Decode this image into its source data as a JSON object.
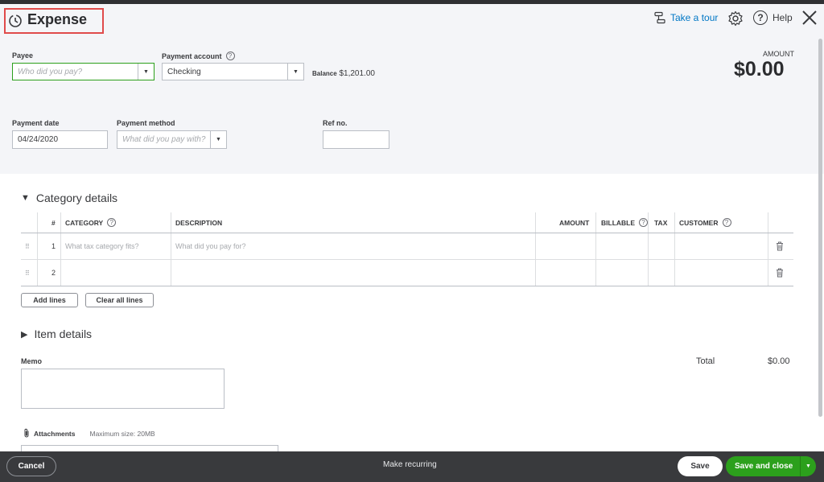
{
  "page": {
    "title": "Expense",
    "take_tour": "Take a tour",
    "help": "Help"
  },
  "form": {
    "payee": {
      "label": "Payee",
      "placeholder": "Who did you pay?"
    },
    "payment_account": {
      "label": "Payment account",
      "value": "Checking"
    },
    "balance": {
      "label": "Balance",
      "value": "$1,201.00"
    },
    "amount": {
      "label": "AMOUNT",
      "value": "$0.00"
    },
    "payment_date": {
      "label": "Payment date",
      "value": "04/24/2020"
    },
    "payment_method": {
      "label": "Payment method",
      "placeholder": "What did you pay with?"
    },
    "ref_no": {
      "label": "Ref no.",
      "value": ""
    }
  },
  "category_details": {
    "title": "Category details",
    "columns": {
      "num": "#",
      "category": "CATEGORY",
      "description": "DESCRIPTION",
      "amount": "AMOUNT",
      "billable": "BILLABLE",
      "tax": "TAX",
      "customer": "CUSTOMER"
    },
    "rows": [
      {
        "num": "1",
        "category_placeholder": "What tax category fits?",
        "description_placeholder": "What did you pay for?"
      },
      {
        "num": "2",
        "category_placeholder": "",
        "description_placeholder": ""
      }
    ],
    "add_lines": "Add lines",
    "clear_all_lines": "Clear all lines"
  },
  "item_details": {
    "title": "Item details"
  },
  "memo": {
    "label": "Memo"
  },
  "total": {
    "label": "Total",
    "value": "$0.00"
  },
  "attachments": {
    "label": "Attachments",
    "max_size": "Maximum size: 20MB"
  },
  "footer": {
    "cancel": "Cancel",
    "make_recurring": "Make recurring",
    "save": "Save",
    "save_and_close": "Save and close"
  },
  "colors": {
    "primary_green": "#2ca01c",
    "link_blue": "#0077c5",
    "highlight_red": "#e04b4b",
    "footer_bg": "#393a3d"
  }
}
